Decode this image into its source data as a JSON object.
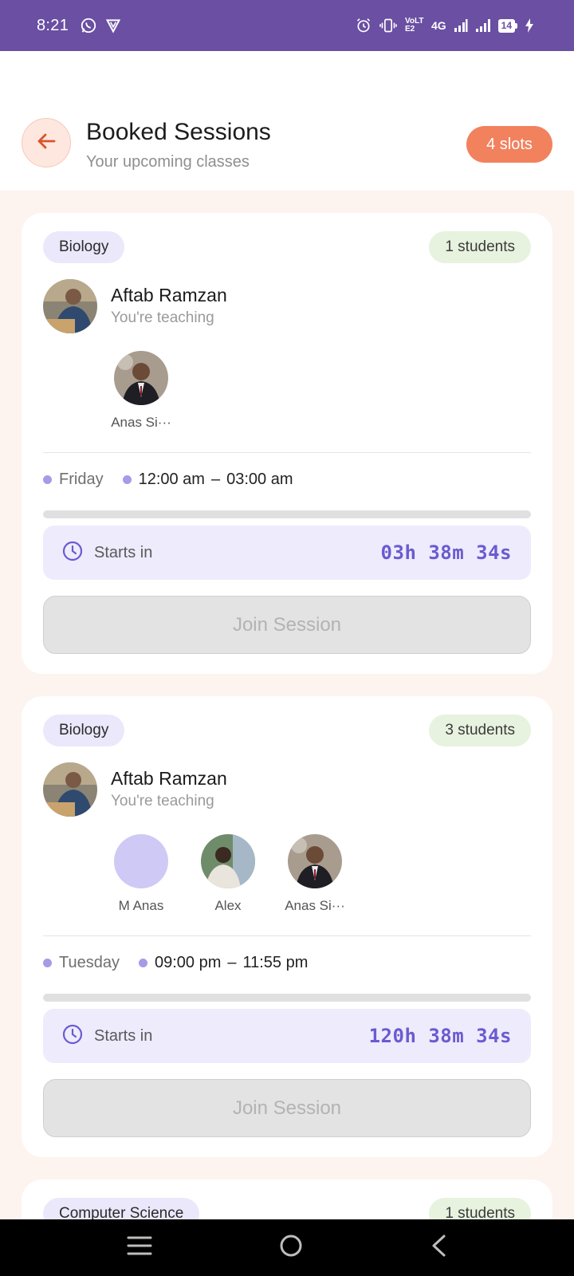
{
  "status_bar": {
    "time": "8:21",
    "network": "4G",
    "volte": "VoLTE2",
    "battery": "14"
  },
  "header": {
    "title": "Booked Sessions",
    "subtitle": "Your upcoming classes",
    "slots_badge": "4 slots"
  },
  "sessions": [
    {
      "subject": "Biology",
      "students_count": "1 students",
      "teacher_name": "Aftab Ramzan",
      "teacher_role": "You're teaching",
      "students": [
        {
          "name": "Anas Si···"
        }
      ],
      "day": "Friday",
      "start_time": "12:00 am",
      "separator": "–",
      "end_time": "03:00 am",
      "progress": 0,
      "starts_label": "Starts in",
      "countdown": "03h 38m 34s",
      "join_label": "Join Session"
    },
    {
      "subject": "Biology",
      "students_count": "3 students",
      "teacher_name": "Aftab Ramzan",
      "teacher_role": "You're teaching",
      "students": [
        {
          "name": "M Anas"
        },
        {
          "name": "Alex"
        },
        {
          "name": "Anas Si···"
        }
      ],
      "day": "Tuesday",
      "start_time": "09:00 pm",
      "separator": "–",
      "end_time": "11:55 pm",
      "progress": 0,
      "starts_label": "Starts in",
      "countdown": "120h 38m 34s",
      "join_label": "Join Session"
    },
    {
      "subject": "Computer Science",
      "students_count": "1 students"
    }
  ],
  "colors": {
    "status_bar": "#6a4fa3",
    "accent": "#f2815e",
    "countdown": "#6a5bd0",
    "background": "#fdf3ef"
  },
  "icons": {
    "back": "arrow-left-icon",
    "clock": "clock-icon",
    "nav_recents": "recents-icon",
    "nav_home": "home-icon",
    "nav_back": "back-icon"
  }
}
